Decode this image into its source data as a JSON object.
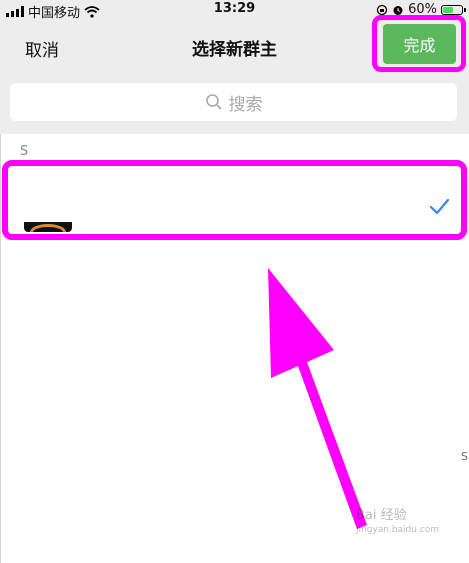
{
  "status_bar": {
    "carrier": "中国移动",
    "time": "13:29",
    "battery": "60%",
    "battery_level": 0.6
  },
  "nav": {
    "cancel_label": "取消",
    "title": "选择新群主",
    "done_label": "完成"
  },
  "search": {
    "placeholder": "搜索",
    "icon": "search-icon"
  },
  "list": {
    "section_letter": "S",
    "items": [
      {
        "avatar": "avatar",
        "selected": true,
        "check_icon": "checkmark-icon"
      }
    ]
  },
  "side_index_letter": "S",
  "watermark": {
    "text": "Bai 经验",
    "url": "jingyan.baidu.com"
  },
  "colors": {
    "accent_green": "#5cb85c",
    "annotation_magenta": "#ff00ff",
    "check_blue": "#3b82f6"
  }
}
